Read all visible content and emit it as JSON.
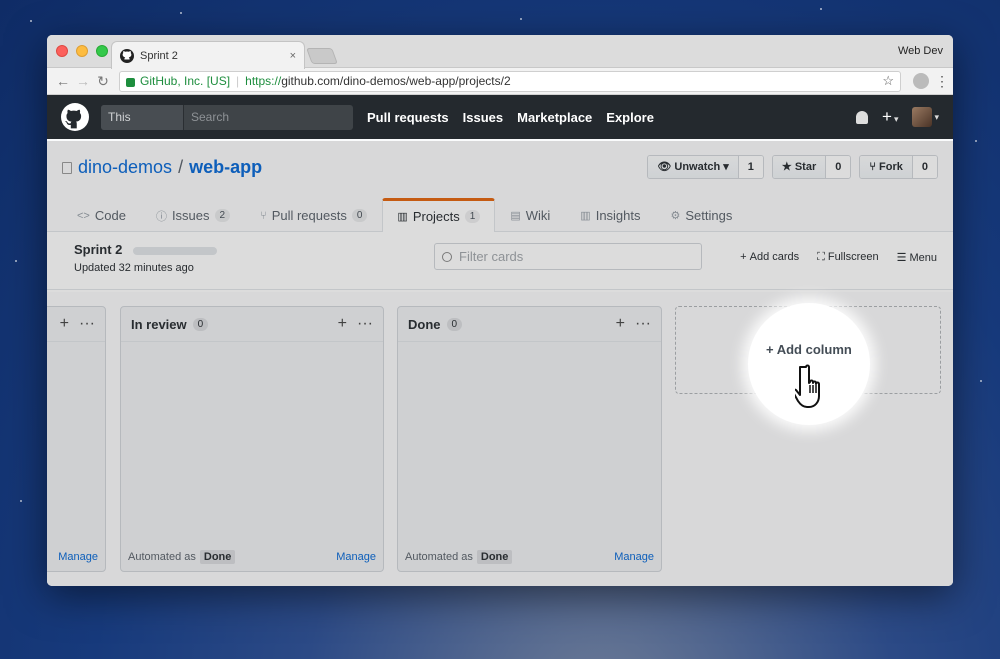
{
  "browser": {
    "tab_title": "Sprint 2",
    "tab_close": "×",
    "profile_name": "Web Dev",
    "org_label": "GitHub, Inc. [US]",
    "url_scheme": "https://",
    "url_rest": "github.com/dino-demos/web-app/projects/2",
    "back_glyph": "←",
    "forward_glyph": "→",
    "reload_glyph": "↻",
    "bookmark_glyph": "☆",
    "menu_glyph": "⋮",
    "separator": "|"
  },
  "gh_header": {
    "search_scope": "This repository",
    "search_placeholder": "Search",
    "nav": [
      "Pull requests",
      "Issues",
      "Marketplace",
      "Explore"
    ],
    "plus": "+",
    "caret": "▾"
  },
  "repo": {
    "owner": "dino-demos",
    "slash": "/",
    "name": "web-app",
    "unwatch_label": "Unwatch",
    "watch_count": "1",
    "star_label": "Star",
    "star_count": "0",
    "fork_label": "Fork",
    "fork_count": "0",
    "tabs": [
      {
        "label": "Code",
        "icon": "<>"
      },
      {
        "label": "Issues",
        "icon": "ⓘ",
        "count": "2"
      },
      {
        "label": "Pull requests",
        "icon": "⑂",
        "count": "0"
      },
      {
        "label": "Projects",
        "icon": "▥",
        "count": "1"
      },
      {
        "label": "Wiki",
        "icon": "▤"
      },
      {
        "label": "Insights",
        "icon": "▥"
      },
      {
        "label": "Settings",
        "icon": "⚙"
      }
    ]
  },
  "project": {
    "name": "Sprint 2",
    "updated": "Updated 32 minutes ago",
    "filter_placeholder": "Filter cards",
    "add_cards": "Add cards",
    "fullscreen": "Fullscreen",
    "menu": "Menu"
  },
  "board": {
    "columns": [
      {
        "title": "",
        "count": "",
        "manage": "Manage"
      },
      {
        "title": "In review",
        "count": "0",
        "automated": "Automated as",
        "automated_tag": "Done",
        "manage": "Manage"
      },
      {
        "title": "Done",
        "count": "0",
        "automated": "Automated as",
        "automated_tag": "Done",
        "manage": "Manage"
      }
    ],
    "col_plus": "+",
    "col_more": "···",
    "add_column": "+ Add column"
  },
  "colors": {
    "link": "#0366d6",
    "header_bg": "#24292e",
    "selected_tab_accent": "#e36209"
  }
}
